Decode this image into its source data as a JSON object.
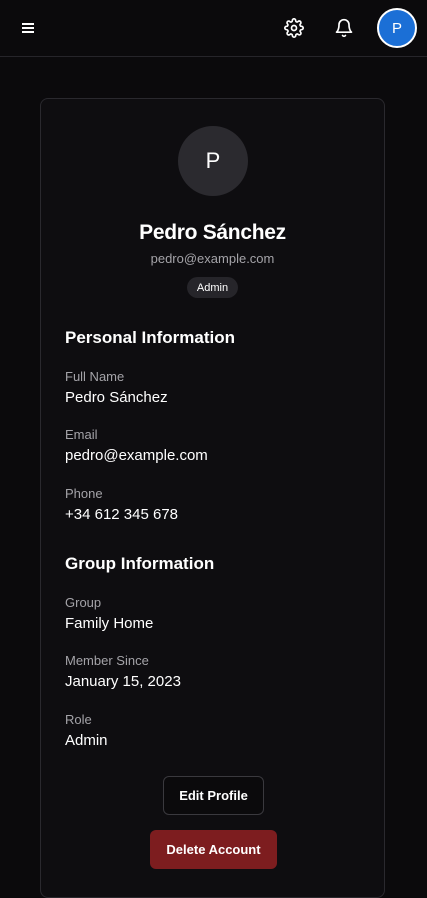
{
  "header": {
    "menu_icon": "menu-icon",
    "settings_icon": "gear-icon",
    "notifications_icon": "bell-icon",
    "avatar_initial": "P",
    "accent_color": "#1b6fd6"
  },
  "profile": {
    "avatar_initial": "P",
    "name": "Pedro Sánchez",
    "email": "pedro@example.com",
    "role_badge": "Admin"
  },
  "personal_information": {
    "title": "Personal Information",
    "fields": [
      {
        "label": "Full Name",
        "value": "Pedro Sánchez"
      },
      {
        "label": "Email",
        "value": "pedro@example.com"
      },
      {
        "label": "Phone",
        "value": "+34 612 345 678"
      }
    ]
  },
  "group_information": {
    "title": "Group Information",
    "fields": [
      {
        "label": "Group",
        "value": "Family Home"
      },
      {
        "label": "Member Since",
        "value": "January 15, 2023"
      },
      {
        "label": "Role",
        "value": "Admin"
      }
    ]
  },
  "actions": {
    "edit_label": "Edit Profile",
    "delete_label": "Delete Account",
    "delete_color": "#7d1d1f"
  }
}
